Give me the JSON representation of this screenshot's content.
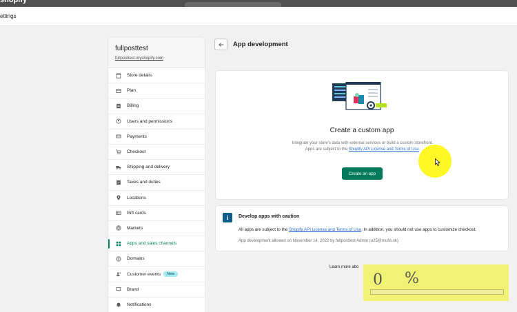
{
  "topbar": {
    "brand": "shopify"
  },
  "titlebar": {
    "title": "ettings"
  },
  "store": {
    "name": "fullposttest",
    "url": "fullposttest.myshopify.com"
  },
  "sidebar": {
    "items": [
      {
        "label": "Store details",
        "icon": "store-icon"
      },
      {
        "label": "Plan",
        "icon": "plan-icon"
      },
      {
        "label": "Billing",
        "icon": "billing-icon"
      },
      {
        "label": "Users and permissions",
        "icon": "user-icon"
      },
      {
        "label": "Payments",
        "icon": "payments-icon"
      },
      {
        "label": "Checkout",
        "icon": "cart-icon"
      },
      {
        "label": "Shipping and delivery",
        "icon": "truck-icon"
      },
      {
        "label": "Taxes and duties",
        "icon": "tax-icon"
      },
      {
        "label": "Locations",
        "icon": "location-pin-icon"
      },
      {
        "label": "Gift cards",
        "icon": "gift-card-icon"
      },
      {
        "label": "Markets",
        "icon": "globe-icon"
      },
      {
        "label": "Apps and sales channels",
        "icon": "apps-grid-icon",
        "active": true
      },
      {
        "label": "Domains",
        "icon": "domains-globe-icon"
      },
      {
        "label": "Customer events",
        "icon": "customer-events-icon",
        "badge": "New"
      },
      {
        "label": "Brand",
        "icon": "brand-icon"
      },
      {
        "label": "Notifications",
        "icon": "bell-icon"
      }
    ]
  },
  "header": {
    "title": "App development"
  },
  "create_card": {
    "title": "Create a custom app",
    "desc_pre": "Integrate your store's data with external services or build a custom storefront. Apps are subject to the ",
    "desc_link": "Shopify API License and Terms of Use",
    "desc_post": ".",
    "button": "Create an app"
  },
  "caution_card": {
    "title": "Develop apps with caution",
    "line1_pre": "All apps are subject to the ",
    "line1_link": "Shopify API License and Terms of Use",
    "line1_post": ". In addition, you should not use apps to customize checkout.",
    "line2": "App development allowed on November 14, 2022 by fullposttest Admin (u25@mufis.sk)."
  },
  "footer": {
    "learn_more": "Learn more abo"
  },
  "overlay": {
    "progress_number": "0",
    "progress_symbol": "%",
    "progress_fraction": 0
  },
  "colors": {
    "accent": "#008060",
    "button": "#007a5a",
    "link": "#2c6ecb",
    "highlight": "#fff700"
  }
}
